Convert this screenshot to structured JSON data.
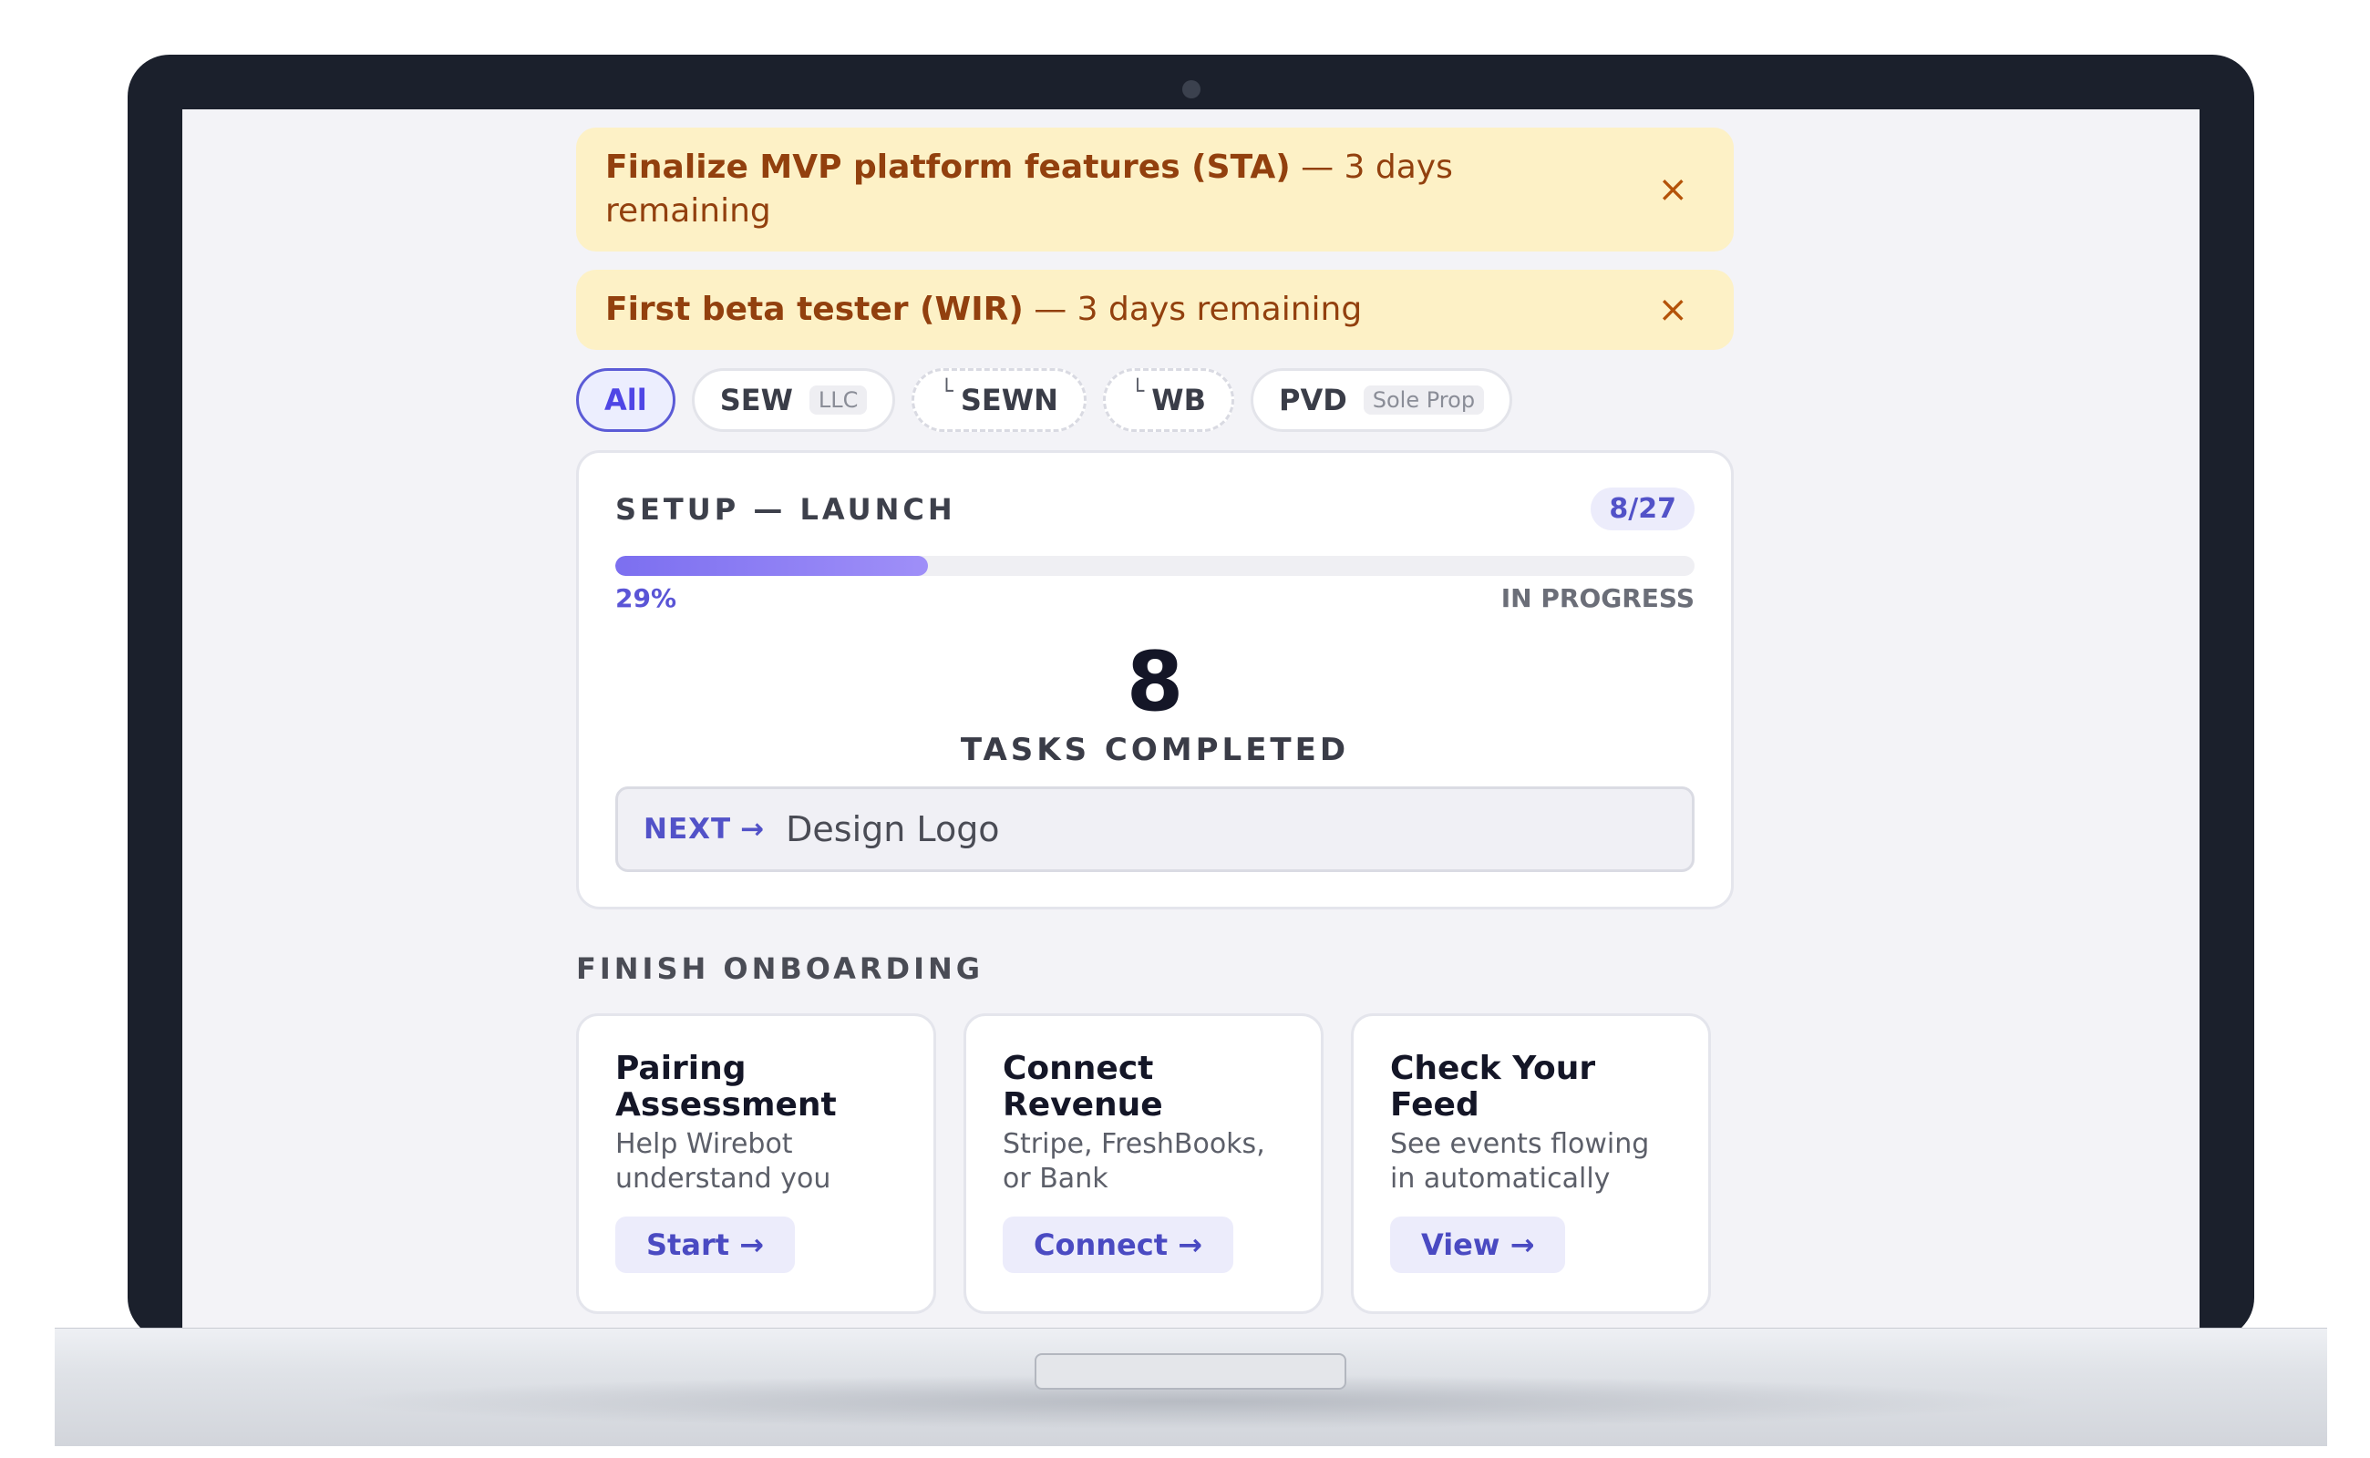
{
  "alerts": [
    {
      "title": "Finalize MVP platform features (STA)",
      "suffix": "— 3 days remaining",
      "close": "×"
    },
    {
      "title": "First beta tester (WIR)",
      "suffix": "— 3 days remaining",
      "close": "×"
    }
  ],
  "filters": [
    {
      "label": "All",
      "active": true
    },
    {
      "label": "SEW",
      "tag": "LLC"
    },
    {
      "prefix": "└",
      "label": "SEWN"
    },
    {
      "prefix": "└",
      "label": "WB"
    },
    {
      "label": "PVD",
      "tag": "Sole Prop"
    }
  ],
  "progress_card": {
    "title": "SETUP — LAUNCH",
    "count": "8/27",
    "progress_fraction": 0.29,
    "percent_label": "29%",
    "status": "IN PROGRESS",
    "big_number": "8",
    "big_label": "TASKS COMPLETED",
    "next_label": "NEXT",
    "next_arrow": "→",
    "next_value": "Design Logo"
  },
  "onboarding": {
    "title": "FINISH ONBOARDING",
    "cards": [
      {
        "title": "Pairing Assessment",
        "desc": "Help Wirebot understand you",
        "button": "Start →"
      },
      {
        "title": "Connect Revenue",
        "desc": "Stripe, FreshBooks, or Bank",
        "button": "Connect →"
      },
      {
        "title": "Check Your Feed",
        "desc": "See events flowing in automatically",
        "button": "View →"
      }
    ]
  },
  "colors": {
    "accent": "#5252c8",
    "alert_bg": "#fdf1c6",
    "alert_text": "#92400e",
    "laptop_frame": "#1b202c"
  }
}
